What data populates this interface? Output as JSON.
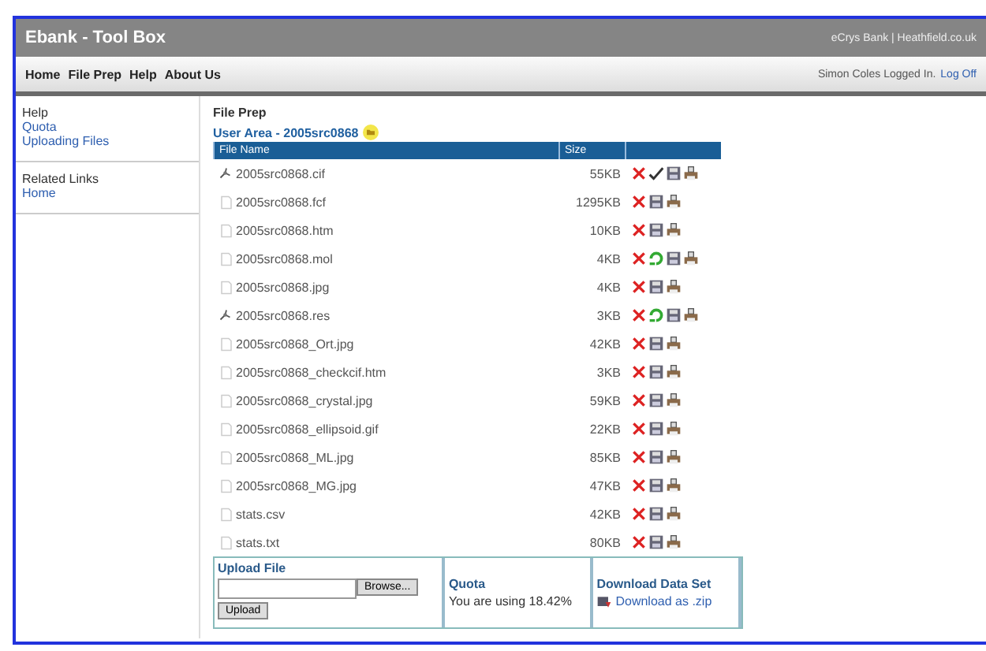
{
  "window": {
    "title": "Ebank - Tool Box",
    "top_right": "eCrys Bank | Heathfield.co.uk"
  },
  "nav": {
    "items": [
      "Home",
      "File Prep",
      "Help",
      "About Us"
    ],
    "user": "Simon Coles Logged In.",
    "logoff": "Log Off"
  },
  "sidebar": {
    "sections": [
      {
        "heading": "Help",
        "links": [
          "Quota",
          "Uploading Files"
        ]
      },
      {
        "heading": "Related Links",
        "links": [
          "Home"
        ]
      }
    ]
  },
  "main": {
    "title": "File Prep",
    "user_area": "User Area - 2005src0868",
    "table": {
      "columns": [
        "File Name",
        "Size"
      ],
      "rows": [
        {
          "name": "2005src0868.cif",
          "size": "55KB",
          "kind": "structure",
          "actions": [
            {
              "kind": "delete"
            },
            {
              "kind": "check"
            },
            {
              "kind": "save"
            },
            {
              "kind": "print"
            }
          ]
        },
        {
          "name": "2005src0868.fcf",
          "size": "1295KB",
          "kind": "plain",
          "actions": [
            {
              "kind": "delete"
            },
            {
              "kind": "save"
            },
            {
              "kind": "print"
            }
          ]
        },
        {
          "name": "2005src0868.htm",
          "size": "10KB",
          "kind": "plain",
          "actions": [
            {
              "kind": "delete"
            },
            {
              "kind": "save"
            },
            {
              "kind": "print"
            }
          ]
        },
        {
          "name": "2005src0868.mol",
          "size": "4KB",
          "kind": "plain",
          "actions": [
            {
              "kind": "delete"
            },
            {
              "kind": "convert"
            },
            {
              "kind": "save"
            },
            {
              "kind": "print"
            }
          ]
        },
        {
          "name": "2005src0868.jpg",
          "size": "4KB",
          "kind": "plain",
          "actions": [
            {
              "kind": "delete"
            },
            {
              "kind": "save"
            },
            {
              "kind": "print"
            }
          ]
        },
        {
          "name": "2005src0868.res",
          "size": "3KB",
          "kind": "structure",
          "actions": [
            {
              "kind": "delete"
            },
            {
              "kind": "convert"
            },
            {
              "kind": "save"
            },
            {
              "kind": "print"
            }
          ]
        },
        {
          "name": "2005src0868_Ort.jpg",
          "size": "42KB",
          "kind": "plain",
          "actions": [
            {
              "kind": "delete"
            },
            {
              "kind": "save"
            },
            {
              "kind": "print"
            }
          ]
        },
        {
          "name": "2005src0868_checkcif.htm",
          "size": "3KB",
          "kind": "plain",
          "actions": [
            {
              "kind": "delete"
            },
            {
              "kind": "save"
            },
            {
              "kind": "print"
            }
          ]
        },
        {
          "name": "2005src0868_crystal.jpg",
          "size": "59KB",
          "kind": "plain",
          "actions": [
            {
              "kind": "delete"
            },
            {
              "kind": "save"
            },
            {
              "kind": "print"
            }
          ]
        },
        {
          "name": "2005src0868_ellipsoid.gif",
          "size": "22KB",
          "kind": "plain",
          "actions": [
            {
              "kind": "delete"
            },
            {
              "kind": "save"
            },
            {
              "kind": "print"
            }
          ]
        },
        {
          "name": "2005src0868_ML.jpg",
          "size": "85KB",
          "kind": "plain",
          "actions": [
            {
              "kind": "delete"
            },
            {
              "kind": "save"
            },
            {
              "kind": "print"
            }
          ]
        },
        {
          "name": "2005src0868_MG.jpg",
          "size": "47KB",
          "kind": "plain",
          "actions": [
            {
              "kind": "delete"
            },
            {
              "kind": "save"
            },
            {
              "kind": "print"
            }
          ]
        },
        {
          "name": "stats.csv",
          "size": "42KB",
          "kind": "plain",
          "actions": [
            {
              "kind": "delete"
            },
            {
              "kind": "save"
            },
            {
              "kind": "print"
            }
          ]
        },
        {
          "name": "stats.txt",
          "size": "80KB",
          "kind": "plain",
          "actions": [
            {
              "kind": "delete"
            },
            {
              "kind": "save"
            },
            {
              "kind": "print"
            }
          ]
        }
      ]
    },
    "upload": {
      "title": "Upload File",
      "browse": "Browse...",
      "button": "Upload"
    },
    "quota": {
      "title": "Quota",
      "text": "You are using 18.42%"
    },
    "download": {
      "title": "Download Data Set",
      "link": "Download as .zip"
    }
  }
}
